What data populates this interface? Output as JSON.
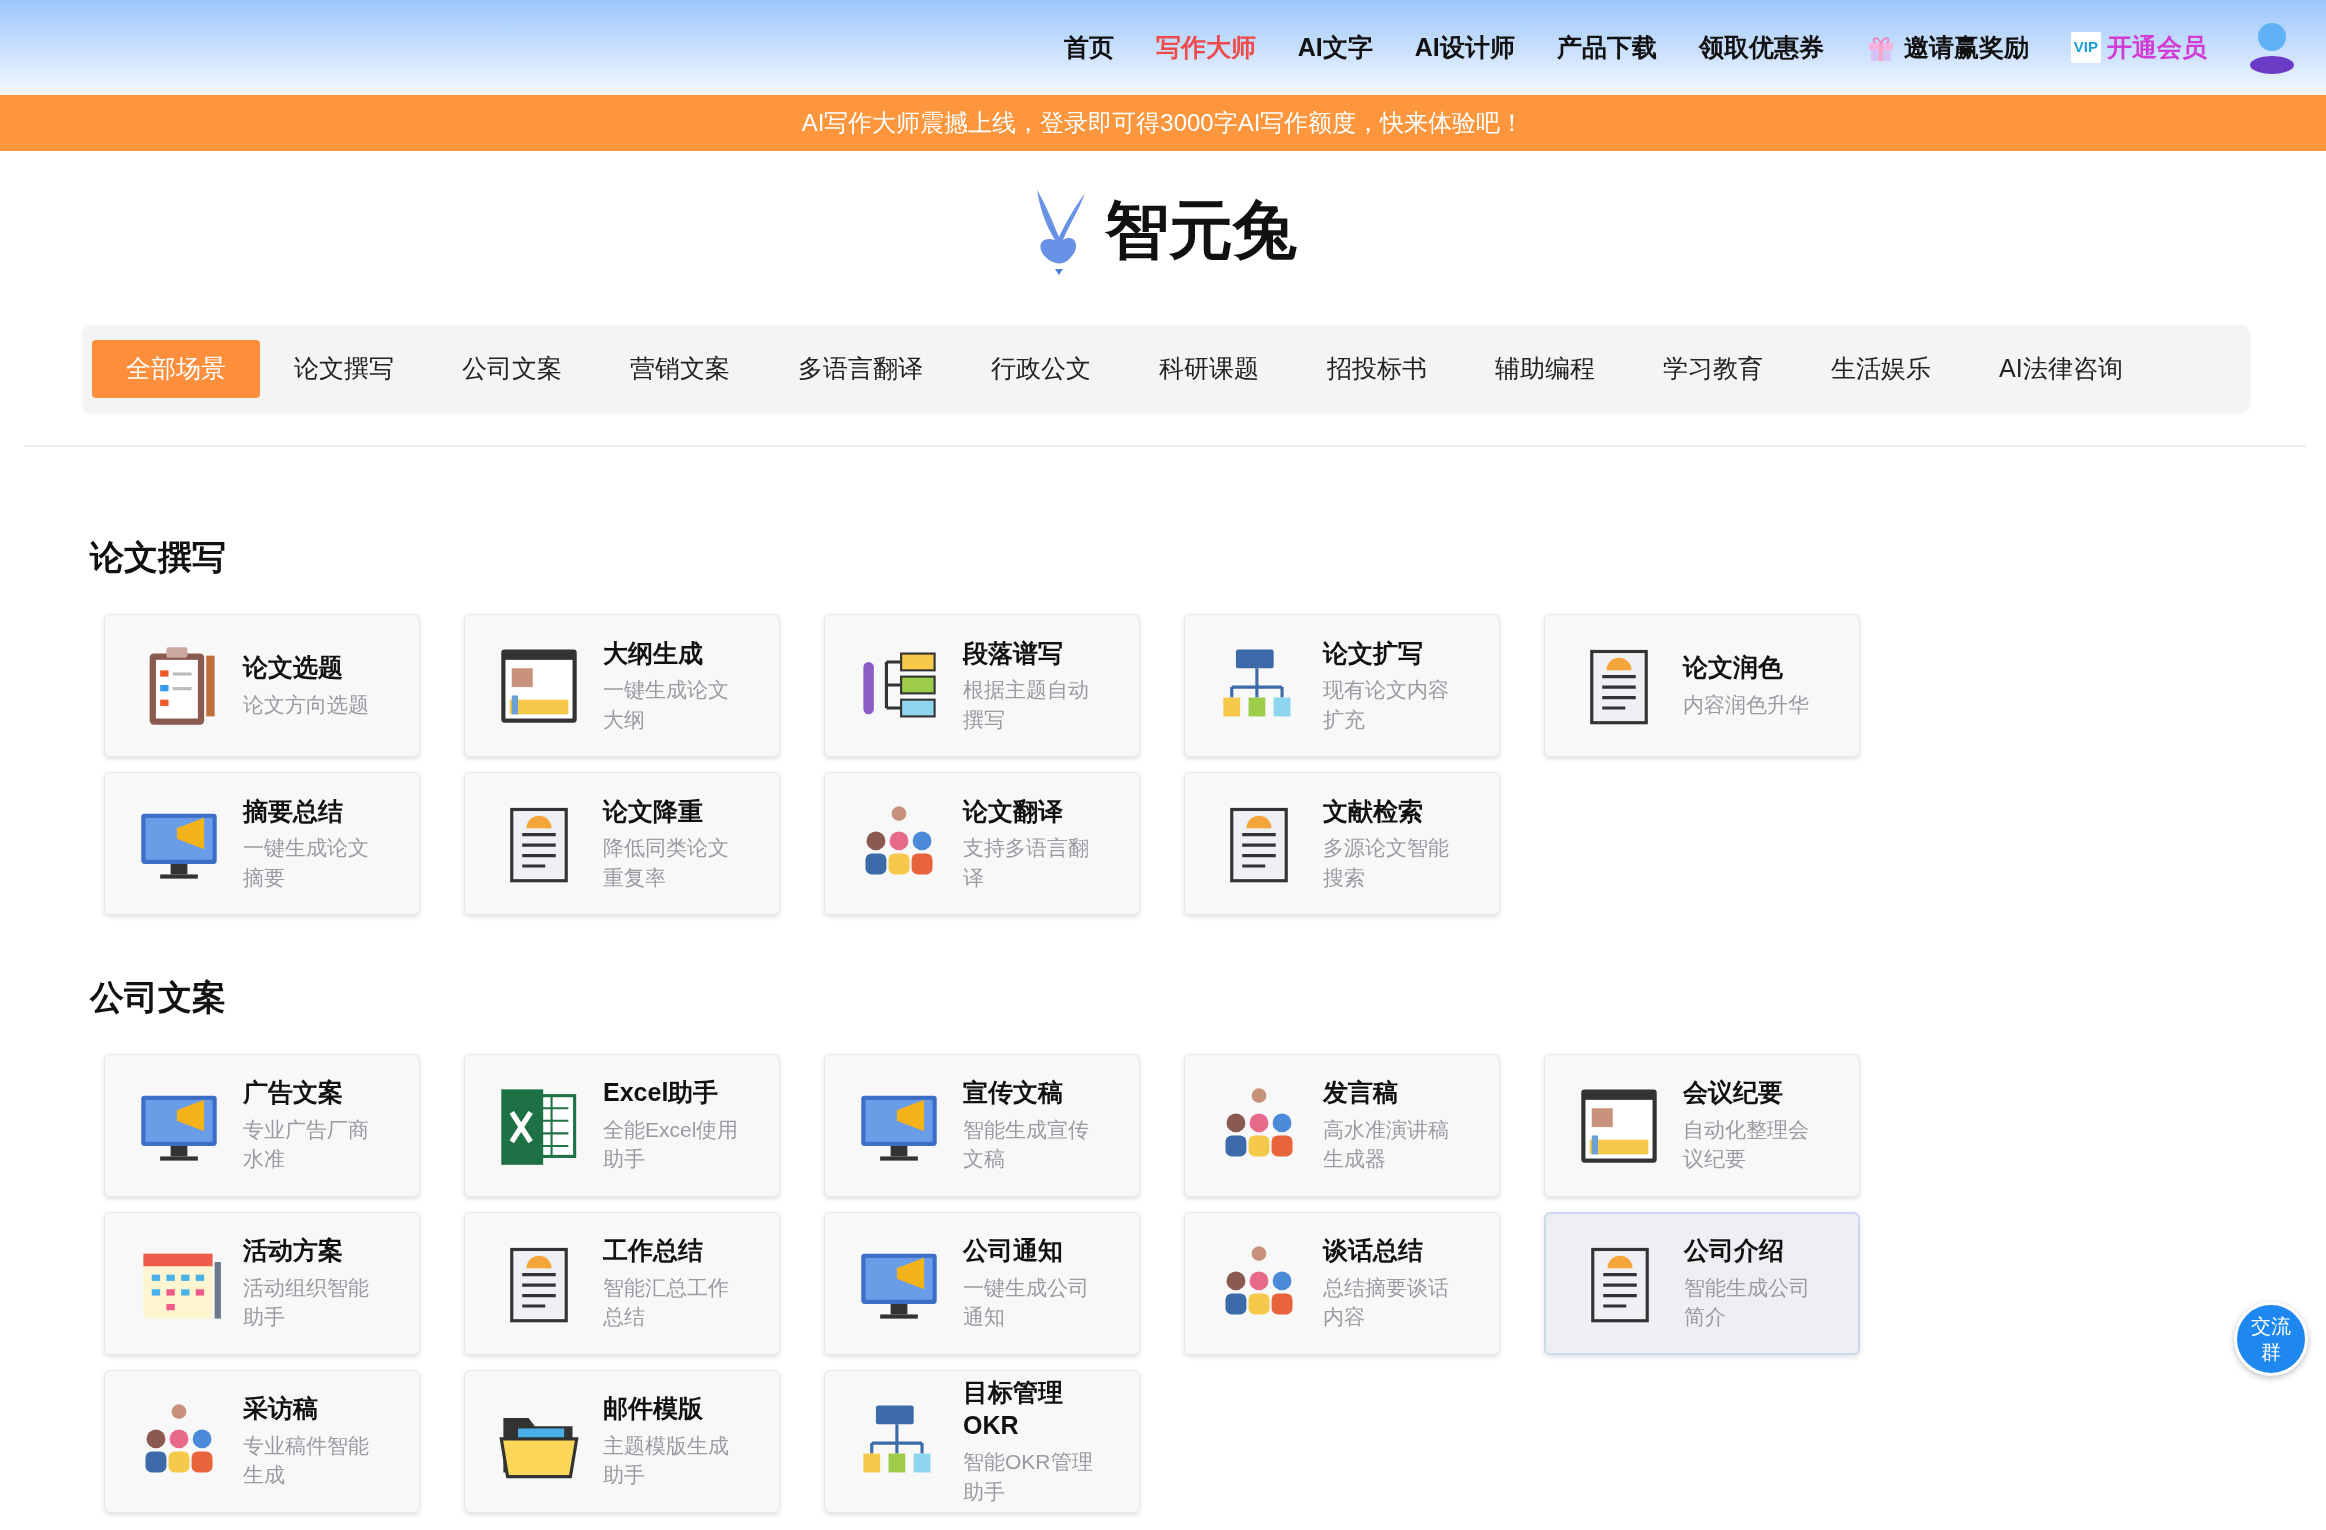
{
  "nav": {
    "items": [
      {
        "label": "首页",
        "selected": false,
        "kind": "text"
      },
      {
        "label": "写作大师",
        "selected": true,
        "kind": "text"
      },
      {
        "label": "AI文字",
        "selected": false,
        "kind": "text"
      },
      {
        "label": "AI设计师",
        "selected": false,
        "kind": "text"
      },
      {
        "label": "产品下载",
        "selected": false,
        "kind": "text"
      },
      {
        "label": "领取优惠券",
        "selected": false,
        "kind": "text"
      },
      {
        "label": "邀请赢奖励",
        "selected": false,
        "kind": "gift"
      },
      {
        "label": "开通会员",
        "selected": false,
        "kind": "vip"
      }
    ],
    "vip_badge": "VIP"
  },
  "banner": "AI写作大师震撼上线，登录即可得3000字AI写作额度，快来体验吧！",
  "brand": "智元兔",
  "categories": [
    {
      "label": "全部场景",
      "selected": true
    },
    {
      "label": "论文撰写",
      "selected": false
    },
    {
      "label": "公司文案",
      "selected": false
    },
    {
      "label": "营销文案",
      "selected": false
    },
    {
      "label": "多语言翻译",
      "selected": false
    },
    {
      "label": "行政公文",
      "selected": false
    },
    {
      "label": "科研课题",
      "selected": false
    },
    {
      "label": "招投标书",
      "selected": false
    },
    {
      "label": "辅助编程",
      "selected": false
    },
    {
      "label": "学习教育",
      "selected": false
    },
    {
      "label": "生活娱乐",
      "selected": false
    },
    {
      "label": "AI法律咨询",
      "selected": false
    }
  ],
  "sections": [
    {
      "title": "论文撰写",
      "cards": [
        {
          "title": "论文选题",
          "desc": "论文方向选题",
          "highlighted": false
        },
        {
          "title": "大纲生成",
          "desc": "一键生成论文大纲",
          "highlighted": false
        },
        {
          "title": "段落谱写",
          "desc": "根据主题自动撰写",
          "highlighted": false
        },
        {
          "title": "论文扩写",
          "desc": "现有论文内容扩充",
          "highlighted": false
        },
        {
          "title": "论文润色",
          "desc": "内容润色升华",
          "highlighted": false
        },
        {
          "title": "摘要总结",
          "desc": "一键生成论文摘要",
          "highlighted": false
        },
        {
          "title": "论文降重",
          "desc": "降低同类论文重复率",
          "highlighted": false
        },
        {
          "title": "论文翻译",
          "desc": "支持多语言翻译",
          "highlighted": false
        },
        {
          "title": "文献检索",
          "desc": "多源论文智能搜索",
          "highlighted": false
        }
      ]
    },
    {
      "title": "公司文案",
      "cards": [
        {
          "title": "广告文案",
          "desc": "专业广告厂商水准",
          "highlighted": false
        },
        {
          "title": "Excel助手",
          "desc": "全能Excel使用助手",
          "highlighted": false
        },
        {
          "title": "宣传文稿",
          "desc": "智能生成宣传文稿",
          "highlighted": false
        },
        {
          "title": "发言稿",
          "desc": "高水准演讲稿生成器",
          "highlighted": false
        },
        {
          "title": "会议纪要",
          "desc": "自动化整理会议纪要",
          "highlighted": false
        },
        {
          "title": "活动方案",
          "desc": "活动组织智能助手",
          "highlighted": false
        },
        {
          "title": "工作总结",
          "desc": "智能汇总工作总结",
          "highlighted": false
        },
        {
          "title": "公司通知",
          "desc": "一键生成公司通知",
          "highlighted": false
        },
        {
          "title": "谈话总结",
          "desc": "总结摘要谈话内容",
          "highlighted": false
        },
        {
          "title": "公司介绍",
          "desc": "智能生成公司简介",
          "highlighted": true
        },
        {
          "title": "采访稿",
          "desc": "专业稿件智能生成",
          "highlighted": false
        },
        {
          "title": "邮件模版",
          "desc": "主题模版生成助手",
          "highlighted": false
        },
        {
          "title": "目标管理OKR",
          "desc": "智能OKR管理助手",
          "highlighted": false
        }
      ]
    }
  ],
  "float_button": "交流群"
}
